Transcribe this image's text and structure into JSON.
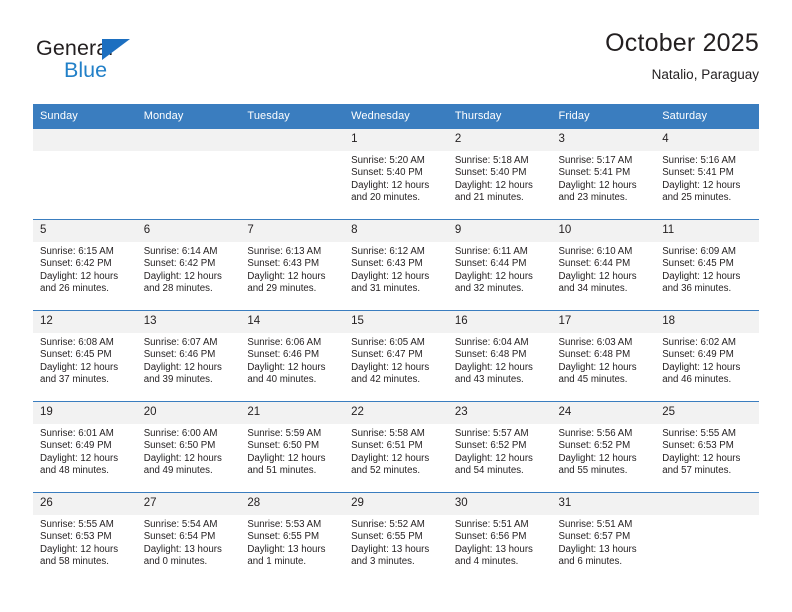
{
  "brand": {
    "name_top": "General",
    "name_bottom": "Blue",
    "accent_color": "#2280c8",
    "triangle_color": "#1c6fc0"
  },
  "header": {
    "title": "October 2025",
    "subtitle": "Natalio, Paraguay"
  },
  "theme": {
    "header_row_bg": "#3a7dbf",
    "day_number_bg": "#f2f2f2",
    "text_color": "#231f20"
  },
  "weekdays": [
    "Sunday",
    "Monday",
    "Tuesday",
    "Wednesday",
    "Thursday",
    "Friday",
    "Saturday"
  ],
  "labels": {
    "sunrise": "Sunrise:",
    "sunset": "Sunset:",
    "daylight": "Daylight:"
  },
  "weeks": [
    [
      {
        "day": "",
        "blank": true
      },
      {
        "day": "",
        "blank": true
      },
      {
        "day": "",
        "blank": true
      },
      {
        "day": "1",
        "sunrise": "Sunrise: 5:20 AM",
        "sunset": "Sunset: 5:40 PM",
        "daylight": "Daylight: 12 hours and 20 minutes."
      },
      {
        "day": "2",
        "sunrise": "Sunrise: 5:18 AM",
        "sunset": "Sunset: 5:40 PM",
        "daylight": "Daylight: 12 hours and 21 minutes."
      },
      {
        "day": "3",
        "sunrise": "Sunrise: 5:17 AM",
        "sunset": "Sunset: 5:41 PM",
        "daylight": "Daylight: 12 hours and 23 minutes."
      },
      {
        "day": "4",
        "sunrise": "Sunrise: 5:16 AM",
        "sunset": "Sunset: 5:41 PM",
        "daylight": "Daylight: 12 hours and 25 minutes."
      }
    ],
    [
      {
        "day": "5",
        "sunrise": "Sunrise: 6:15 AM",
        "sunset": "Sunset: 6:42 PM",
        "daylight": "Daylight: 12 hours and 26 minutes."
      },
      {
        "day": "6",
        "sunrise": "Sunrise: 6:14 AM",
        "sunset": "Sunset: 6:42 PM",
        "daylight": "Daylight: 12 hours and 28 minutes."
      },
      {
        "day": "7",
        "sunrise": "Sunrise: 6:13 AM",
        "sunset": "Sunset: 6:43 PM",
        "daylight": "Daylight: 12 hours and 29 minutes."
      },
      {
        "day": "8",
        "sunrise": "Sunrise: 6:12 AM",
        "sunset": "Sunset: 6:43 PM",
        "daylight": "Daylight: 12 hours and 31 minutes."
      },
      {
        "day": "9",
        "sunrise": "Sunrise: 6:11 AM",
        "sunset": "Sunset: 6:44 PM",
        "daylight": "Daylight: 12 hours and 32 minutes."
      },
      {
        "day": "10",
        "sunrise": "Sunrise: 6:10 AM",
        "sunset": "Sunset: 6:44 PM",
        "daylight": "Daylight: 12 hours and 34 minutes."
      },
      {
        "day": "11",
        "sunrise": "Sunrise: 6:09 AM",
        "sunset": "Sunset: 6:45 PM",
        "daylight": "Daylight: 12 hours and 36 minutes."
      }
    ],
    [
      {
        "day": "12",
        "sunrise": "Sunrise: 6:08 AM",
        "sunset": "Sunset: 6:45 PM",
        "daylight": "Daylight: 12 hours and 37 minutes."
      },
      {
        "day": "13",
        "sunrise": "Sunrise: 6:07 AM",
        "sunset": "Sunset: 6:46 PM",
        "daylight": "Daylight: 12 hours and 39 minutes."
      },
      {
        "day": "14",
        "sunrise": "Sunrise: 6:06 AM",
        "sunset": "Sunset: 6:46 PM",
        "daylight": "Daylight: 12 hours and 40 minutes."
      },
      {
        "day": "15",
        "sunrise": "Sunrise: 6:05 AM",
        "sunset": "Sunset: 6:47 PM",
        "daylight": "Daylight: 12 hours and 42 minutes."
      },
      {
        "day": "16",
        "sunrise": "Sunrise: 6:04 AM",
        "sunset": "Sunset: 6:48 PM",
        "daylight": "Daylight: 12 hours and 43 minutes."
      },
      {
        "day": "17",
        "sunrise": "Sunrise: 6:03 AM",
        "sunset": "Sunset: 6:48 PM",
        "daylight": "Daylight: 12 hours and 45 minutes."
      },
      {
        "day": "18",
        "sunrise": "Sunrise: 6:02 AM",
        "sunset": "Sunset: 6:49 PM",
        "daylight": "Daylight: 12 hours and 46 minutes."
      }
    ],
    [
      {
        "day": "19",
        "sunrise": "Sunrise: 6:01 AM",
        "sunset": "Sunset: 6:49 PM",
        "daylight": "Daylight: 12 hours and 48 minutes."
      },
      {
        "day": "20",
        "sunrise": "Sunrise: 6:00 AM",
        "sunset": "Sunset: 6:50 PM",
        "daylight": "Daylight: 12 hours and 49 minutes."
      },
      {
        "day": "21",
        "sunrise": "Sunrise: 5:59 AM",
        "sunset": "Sunset: 6:50 PM",
        "daylight": "Daylight: 12 hours and 51 minutes."
      },
      {
        "day": "22",
        "sunrise": "Sunrise: 5:58 AM",
        "sunset": "Sunset: 6:51 PM",
        "daylight": "Daylight: 12 hours and 52 minutes."
      },
      {
        "day": "23",
        "sunrise": "Sunrise: 5:57 AM",
        "sunset": "Sunset: 6:52 PM",
        "daylight": "Daylight: 12 hours and 54 minutes."
      },
      {
        "day": "24",
        "sunrise": "Sunrise: 5:56 AM",
        "sunset": "Sunset: 6:52 PM",
        "daylight": "Daylight: 12 hours and 55 minutes."
      },
      {
        "day": "25",
        "sunrise": "Sunrise: 5:55 AM",
        "sunset": "Sunset: 6:53 PM",
        "daylight": "Daylight: 12 hours and 57 minutes."
      }
    ],
    [
      {
        "day": "26",
        "sunrise": "Sunrise: 5:55 AM",
        "sunset": "Sunset: 6:53 PM",
        "daylight": "Daylight: 12 hours and 58 minutes."
      },
      {
        "day": "27",
        "sunrise": "Sunrise: 5:54 AM",
        "sunset": "Sunset: 6:54 PM",
        "daylight": "Daylight: 13 hours and 0 minutes."
      },
      {
        "day": "28",
        "sunrise": "Sunrise: 5:53 AM",
        "sunset": "Sunset: 6:55 PM",
        "daylight": "Daylight: 13 hours and 1 minute."
      },
      {
        "day": "29",
        "sunrise": "Sunrise: 5:52 AM",
        "sunset": "Sunset: 6:55 PM",
        "daylight": "Daylight: 13 hours and 3 minutes."
      },
      {
        "day": "30",
        "sunrise": "Sunrise: 5:51 AM",
        "sunset": "Sunset: 6:56 PM",
        "daylight": "Daylight: 13 hours and 4 minutes."
      },
      {
        "day": "31",
        "sunrise": "Sunrise: 5:51 AM",
        "sunset": "Sunset: 6:57 PM",
        "daylight": "Daylight: 13 hours and 6 minutes."
      },
      {
        "day": "",
        "blank": true
      }
    ]
  ]
}
